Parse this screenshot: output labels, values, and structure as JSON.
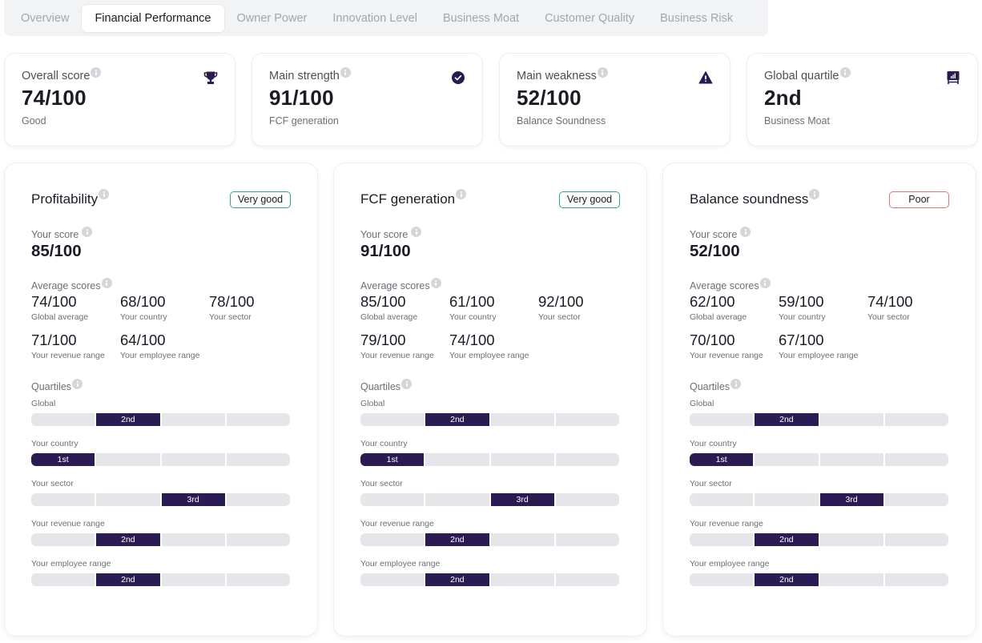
{
  "colors": {
    "accent": "#2a1b52",
    "badge_good": "#2fa883",
    "badge_poor": "#e0747b",
    "segment_inactive": "#e5e6e9"
  },
  "tabs": [
    {
      "label": "Overview",
      "active": false
    },
    {
      "label": "Financial Performance",
      "active": true
    },
    {
      "label": "Owner Power",
      "active": false
    },
    {
      "label": "Innovation Level",
      "active": false
    },
    {
      "label": "Business Moat",
      "active": false
    },
    {
      "label": "Customer Quality",
      "active": false
    },
    {
      "label": "Business Risk",
      "active": false
    }
  ],
  "summary": [
    {
      "label": "Overall score",
      "value": "74/100",
      "sub": "Good",
      "icon": "trophy-icon"
    },
    {
      "label": "Main strength",
      "value": "91/100",
      "sub": "FCF generation",
      "icon": "check-circle-icon"
    },
    {
      "label": "Main weakness",
      "value": "52/100",
      "sub": "Balance Soundness",
      "icon": "warning-icon"
    },
    {
      "label": "Global quartile",
      "value": "2nd",
      "sub": "Business Moat",
      "icon": "presentation-chart-icon"
    }
  ],
  "labels": {
    "your_score": "Your score",
    "average_scores": "Average scores",
    "quartiles": "Quartiles"
  },
  "details": [
    {
      "title": "Profitability",
      "badge": "Very good",
      "badge_type": "good",
      "score": "85/100",
      "averages": [
        {
          "value": "74/100",
          "caption": "Global average"
        },
        {
          "value": "68/100",
          "caption": "Your country"
        },
        {
          "value": "78/100",
          "caption": "Your sector"
        },
        {
          "value": "71/100",
          "caption": "Your revenue range"
        },
        {
          "value": "64/100",
          "caption": "Your employee range"
        }
      ],
      "quartiles": [
        {
          "label": "Global",
          "quartile": 2,
          "text": "2nd"
        },
        {
          "label": "Your country",
          "quartile": 1,
          "text": "1st"
        },
        {
          "label": "Your sector",
          "quartile": 3,
          "text": "3rd"
        },
        {
          "label": "Your revenue range",
          "quartile": 2,
          "text": "2nd"
        },
        {
          "label": "Your employee range",
          "quartile": 2,
          "text": "2nd"
        }
      ]
    },
    {
      "title": "FCF generation",
      "badge": "Very good",
      "badge_type": "good",
      "score": "91/100",
      "averages": [
        {
          "value": "85/100",
          "caption": "Global average"
        },
        {
          "value": "61/100",
          "caption": "Your country"
        },
        {
          "value": "92/100",
          "caption": "Your sector"
        },
        {
          "value": "79/100",
          "caption": "Your revenue range"
        },
        {
          "value": "74/100",
          "caption": "Your employee range"
        }
      ],
      "quartiles": [
        {
          "label": "Global",
          "quartile": 2,
          "text": "2nd"
        },
        {
          "label": "Your country",
          "quartile": 1,
          "text": "1st"
        },
        {
          "label": "Your sector",
          "quartile": 3,
          "text": "3rd"
        },
        {
          "label": "Your revenue range",
          "quartile": 2,
          "text": "2nd"
        },
        {
          "label": "Your employee range",
          "quartile": 2,
          "text": "2nd"
        }
      ]
    },
    {
      "title": "Balance soundness",
      "badge": "Poor",
      "badge_type": "poor",
      "score": "52/100",
      "averages": [
        {
          "value": "62/100",
          "caption": "Global average"
        },
        {
          "value": "59/100",
          "caption": "Your country"
        },
        {
          "value": "74/100",
          "caption": "Your sector"
        },
        {
          "value": "70/100",
          "caption": "Your revenue range"
        },
        {
          "value": "67/100",
          "caption": "Your employee range"
        }
      ],
      "quartiles": [
        {
          "label": "Global",
          "quartile": 2,
          "text": "2nd"
        },
        {
          "label": "Your country",
          "quartile": 1,
          "text": "1st"
        },
        {
          "label": "Your sector",
          "quartile": 3,
          "text": "3rd"
        },
        {
          "label": "Your revenue range",
          "quartile": 2,
          "text": "2nd"
        },
        {
          "label": "Your employee range",
          "quartile": 2,
          "text": "2nd"
        }
      ]
    }
  ]
}
